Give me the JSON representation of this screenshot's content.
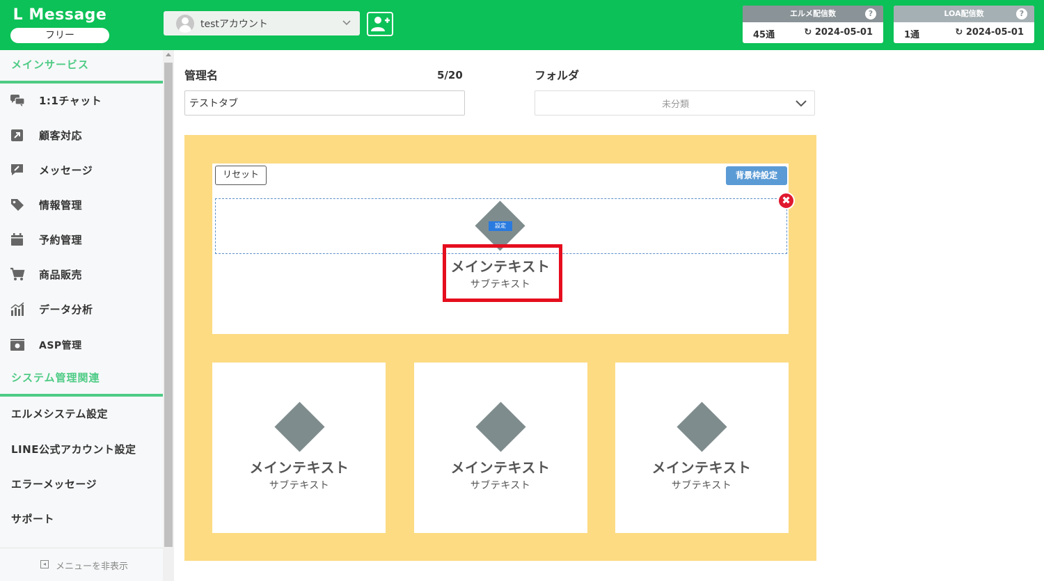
{
  "header": {
    "brand_title": "L Message",
    "brand_plan": "フリー",
    "account_name": "testアカウント",
    "colors": {
      "brand_green": "#0cc157",
      "accent_red": "#e50e1e",
      "canvas_yellow": "#fcdb82"
    },
    "counters": [
      {
        "title": "エルメ配信数",
        "count": "45通",
        "date": "2024-05-01"
      },
      {
        "title": "LOA配信数",
        "count": "1通",
        "date": "2024-05-01"
      }
    ],
    "help_glyph": "?",
    "refresh_glyph": "↻"
  },
  "sidebar": {
    "main_section": "メインサービス",
    "items": [
      {
        "label": "1:1チャット",
        "icon": "chat-icon"
      },
      {
        "label": "顧客対応",
        "icon": "external-link-icon"
      },
      {
        "label": "メッセージ",
        "icon": "pencil-message-icon"
      },
      {
        "label": "情報管理",
        "icon": "tag-icon"
      },
      {
        "label": "予約管理",
        "icon": "calendar-icon"
      },
      {
        "label": "商品販売",
        "icon": "cart-icon"
      },
      {
        "label": "データ分析",
        "icon": "bar-chart-icon"
      },
      {
        "label": "ASP管理",
        "icon": "money-icon"
      }
    ],
    "system_section": "システム管理関連",
    "system_items": [
      {
        "label": "エルメシステム設定"
      },
      {
        "label": "LINE公式アカウント設定"
      },
      {
        "label": "エラーメッセージ"
      },
      {
        "label": "サポート"
      }
    ],
    "hide_menu_label": "メニューを非表示"
  },
  "form": {
    "name_label": "管理名",
    "name_count": "5/20",
    "name_value": "テストタブ",
    "folder_label": "フォルダ",
    "folder_value": "未分類"
  },
  "editor": {
    "reset_label": "リセット",
    "background_label": "背景枠設定",
    "close_glyph": "✖",
    "setting_chip": "設定",
    "top_item": {
      "main": "メインテキスト",
      "sub": "サブテキスト"
    },
    "cards": [
      {
        "main": "メインテキスト",
        "sub": "サブテキスト"
      },
      {
        "main": "メインテキスト",
        "sub": "サブテキスト"
      },
      {
        "main": "メインテキスト",
        "sub": "サブテキスト"
      }
    ]
  }
}
